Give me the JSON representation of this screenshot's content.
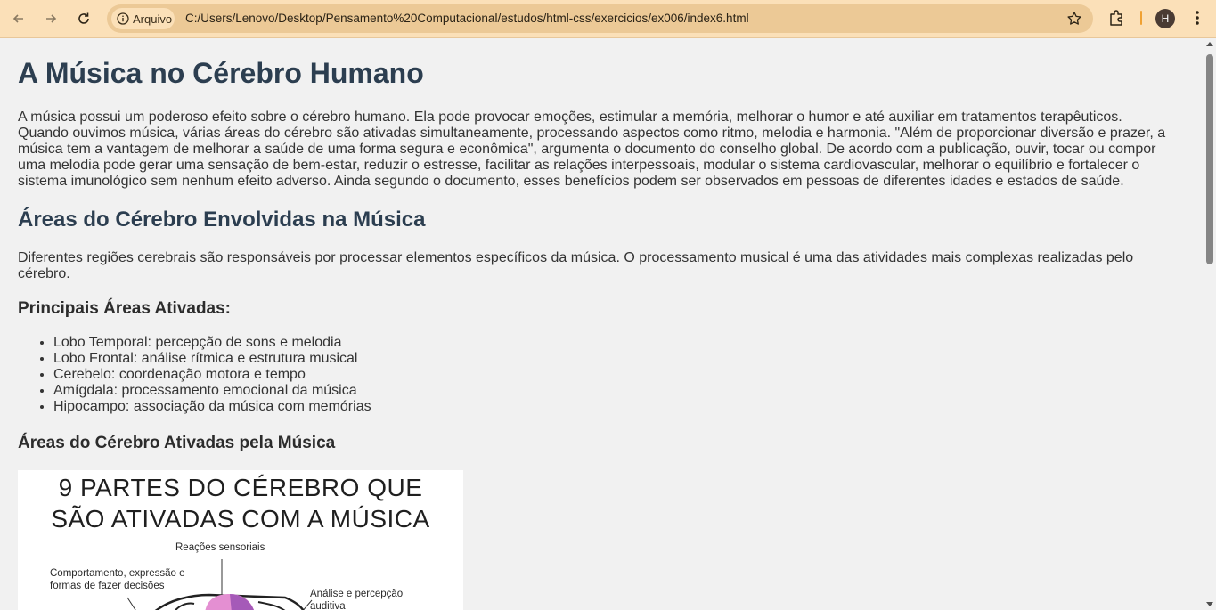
{
  "browser": {
    "chip_label": "Arquivo",
    "url": "C:/Users/Lenovo/Desktop/Pensamento%20Computacional/estudos/html-css/exercicios/ex006/index6.html",
    "avatar_letter": "H",
    "toolbar_color": "#fbe0b8",
    "omnibox_color": "#ecc996",
    "icons": [
      "back-icon",
      "forward-icon",
      "reload-icon",
      "info-icon",
      "star-icon",
      "extensions-icon",
      "more-icon"
    ]
  },
  "page": {
    "title": "A Música no Cérebro Humano",
    "intro": "A música possui um poderoso efeito sobre o cérebro humano. Ela pode provocar emoções, estimular a memória, melhorar o humor e até auxiliar em tratamentos terapêuticos. Quando ouvimos música, várias áreas do cérebro são ativadas simultaneamente, processando aspectos como ritmo, melodia e harmonia. \"Além de proporcionar diversão e prazer, a música tem a vantagem de melhorar a saúde de uma forma segura e econômica\", argumenta o documento do conselho global. De acordo com a publicação, ouvir, tocar ou compor uma melodia pode gerar uma sensação de bem-estar, reduzir o estresse, facilitar as relações interpessoais, modular o sistema cardiovascular, melhorar o equilíbrio e fortalecer o sistema imunológico sem nenhum efeito adverso. Ainda segundo o documento, esses benefícios podem ser observados em pessoas de diferentes idades e estados de saúde.",
    "section_title": "Áreas do Cérebro Envolvidas na Música",
    "section_text": "Diferentes regiões cerebrais são responsáveis por processar elementos específicos da música. O processamento musical é uma das atividades mais complexas realizadas pelo cérebro.",
    "areas_title": "Principais Áreas Ativadas:",
    "areas": [
      "Lobo Temporal: percepção de sons e melodia",
      "Lobo Frontal: análise rítmica e estrutura musical",
      "Cerebelo: coordenação motora e tempo",
      "Amígdala: processamento emocional da música",
      "Hipocampo: associação da música com memórias"
    ],
    "figure_heading": "Áreas do Cérebro Ativadas pela Música",
    "figure": {
      "title_line1": "9 PARTES DO CÉREBRO QUE",
      "title_line2": "SÃO ATIVADAS COM A MÚSICA",
      "label_sensory": "Reações sensoriais",
      "label_behavior_line1": "Comportamento, expressão e",
      "label_behavior_line2": "formas de fazer decisões",
      "label_auditory_line1": "Análise e percepção",
      "label_auditory_line2": "auditiva"
    }
  }
}
